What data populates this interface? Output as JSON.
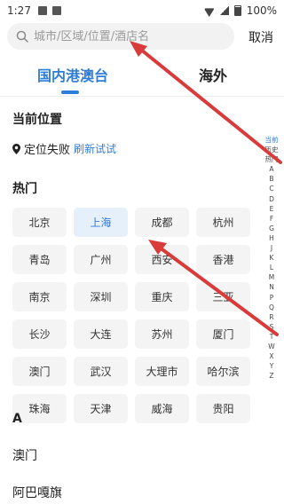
{
  "status_bar": {
    "time": "1:27",
    "battery": "100%"
  },
  "search": {
    "placeholder": "城市/区域/位置/酒店名",
    "cancel_label": "取消"
  },
  "tabs": {
    "domestic": "国内港澳台",
    "overseas": "海外"
  },
  "current_location": {
    "title": "当前位置",
    "status": "定位失败",
    "refresh": "刷新试试"
  },
  "hot": {
    "title": "热门",
    "cities": [
      "北京",
      "上海",
      "成都",
      "杭州",
      "青岛",
      "广州",
      "西安",
      "香港",
      "南京",
      "深圳",
      "重庆",
      "三亚",
      "长沙",
      "大连",
      "苏州",
      "厦门",
      "澳门",
      "武汉",
      "大理市",
      "哈尔滨",
      "珠海",
      "天津",
      "威海",
      "贵阳"
    ],
    "selected": "上海"
  },
  "list": {
    "section_a": "A",
    "items": [
      "澳门",
      "阿巴嘎旗"
    ]
  },
  "index_bar": [
    "当前",
    "历史",
    "热门",
    "A",
    "B",
    "C",
    "D",
    "E",
    "F",
    "G",
    "H",
    "J",
    "K",
    "L",
    "M",
    "N",
    "P",
    "Q",
    "R",
    "S",
    "T",
    "W",
    "X",
    "Y",
    "Z"
  ],
  "colors": {
    "accent": "#2f7ddb",
    "annotation_arrow": "#d93a3a"
  }
}
